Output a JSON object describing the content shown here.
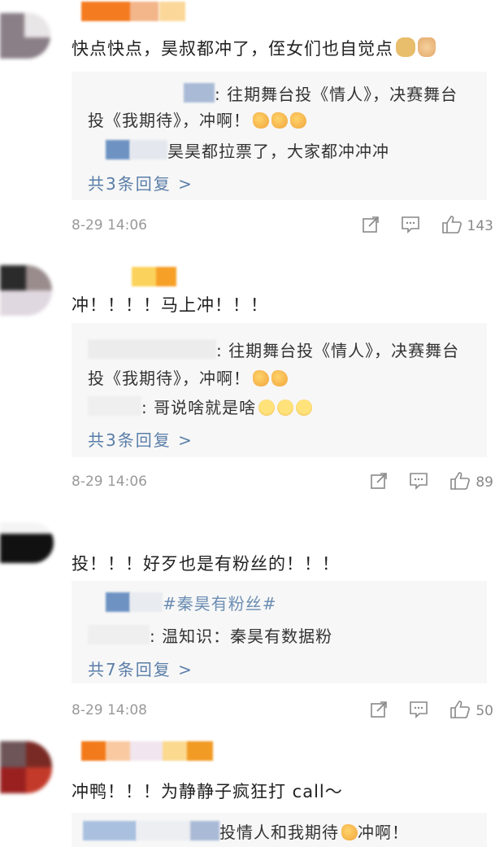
{
  "comments": [
    {
      "text": "快点快点，昊叔都冲了，侄女们也自觉点",
      "replies": [
        {
          "line1": ": 往期舞台投《情人》，决赛舞台",
          "line2": "投《我期待》，冲啊！"
        },
        {
          "text": "昊昊都拉票了，大家都冲冲冲"
        }
      ],
      "more": "共3条回复 >",
      "time": "8-29 14:06",
      "likes": "143"
    },
    {
      "text": "冲！！！！马上冲！！！",
      "replies": [
        {
          "line1": ": 往期舞台投《情人》，决赛舞台",
          "line2": "投《我期待》，冲啊！"
        },
        {
          "text": ": 哥说啥就是啥"
        }
      ],
      "more": "共3条回复 >",
      "time": "8-29 14:06",
      "likes": "89"
    },
    {
      "text": "投！！！好歹也是有粉丝的！！！",
      "replies": [
        {
          "text": "#秦昊有粉丝#"
        },
        {
          "text": ": 温知识：秦昊有数据粉"
        }
      ],
      "more": "共7条回复 >",
      "time": "8-29 14:08",
      "likes": "50"
    },
    {
      "text": "冲鸭！！！为静静子疯狂打 call～",
      "replies": [
        {
          "text": "投情人和我期待",
          "suffix": "冲啊！"
        }
      ]
    }
  ],
  "icons": {
    "share": "share-icon",
    "comment": "comment-icon",
    "like": "thumbs-up-icon"
  },
  "colors": {
    "link": "#5a7ea8",
    "meta": "#999999",
    "reply_bg": "#f7f7f7"
  }
}
